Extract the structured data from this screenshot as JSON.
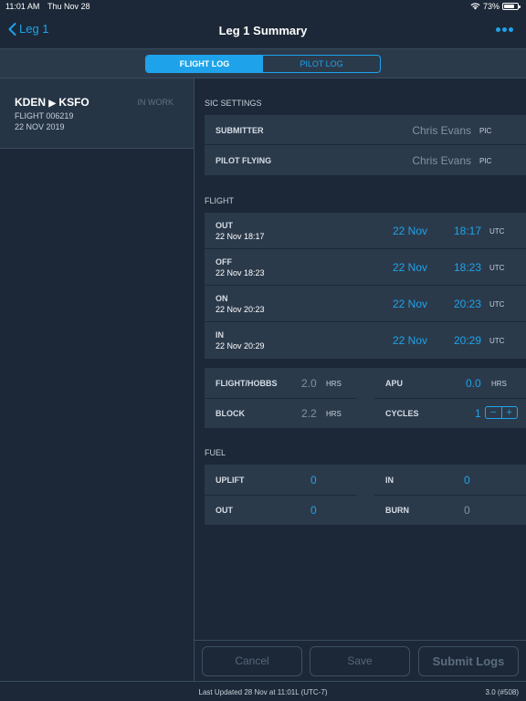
{
  "status_bar": {
    "time": "11:01 AM",
    "date": "Thu Nov 28",
    "battery": "73%"
  },
  "nav": {
    "back_label": "Leg 1",
    "title": "Leg 1 Summary",
    "more_icon": "ellipsis-icon"
  },
  "segments": {
    "flight_log": "FLIGHT LOG",
    "pilot_log": "PILOT LOG",
    "selected": "FLIGHT LOG"
  },
  "leg": {
    "origin": "KDEN",
    "destination": "KSFO",
    "flight": "FLIGHT 006219",
    "date": "22 NOV 2019",
    "status": "IN WORK"
  },
  "sic_settings": {
    "heading": "SIC SETTINGS",
    "rows": [
      {
        "label": "SUBMITTER",
        "value": "Chris Evans",
        "role": "PIC"
      },
      {
        "label": "PILOT FLYING",
        "value": "Chris Evans",
        "role": "PIC"
      }
    ]
  },
  "flight": {
    "heading": "FLIGHT",
    "events": [
      {
        "label": "OUT",
        "sub": "22 Nov 18:17",
        "date": "22 Nov",
        "time": "18:17",
        "tz": "UTC"
      },
      {
        "label": "OFF",
        "sub": "22 Nov 18:23",
        "date": "22 Nov",
        "time": "18:23",
        "tz": "UTC"
      },
      {
        "label": "ON",
        "sub": "22 Nov 20:23",
        "date": "22 Nov",
        "time": "20:23",
        "tz": "UTC"
      },
      {
        "label": "IN",
        "sub": "22 Nov 20:29",
        "date": "22 Nov",
        "time": "20:29",
        "tz": "UTC"
      }
    ],
    "totals": {
      "hobbs": {
        "label": "FLIGHT/HOBBS",
        "value": "2.0",
        "unit": "HRS"
      },
      "apu": {
        "label": "APU",
        "value": "0.0",
        "unit": "HRS"
      },
      "block": {
        "label": "BLOCK",
        "value": "2.2",
        "unit": "HRS"
      },
      "cycles": {
        "label": "CYCLES",
        "value": "1",
        "minus": "−",
        "plus": "+"
      }
    }
  },
  "fuel": {
    "heading": "FUEL",
    "uplift": {
      "label": "UPLIFT",
      "value": "0"
    },
    "in": {
      "label": "IN",
      "value": "0"
    },
    "out": {
      "label": "OUT",
      "value": "0"
    },
    "burn": {
      "label": "BURN",
      "value": "0"
    }
  },
  "footer": {
    "cancel": "Cancel",
    "save": "Save",
    "submit": "Submit Logs"
  },
  "bottom": {
    "last_updated": "Last Updated 28 Nov at 11:01L (UTC-7)",
    "version": "3.0 (#508)"
  },
  "colors": {
    "accent": "#1ea3ea",
    "background": "#1c2837",
    "card": "#2b3a4b"
  }
}
